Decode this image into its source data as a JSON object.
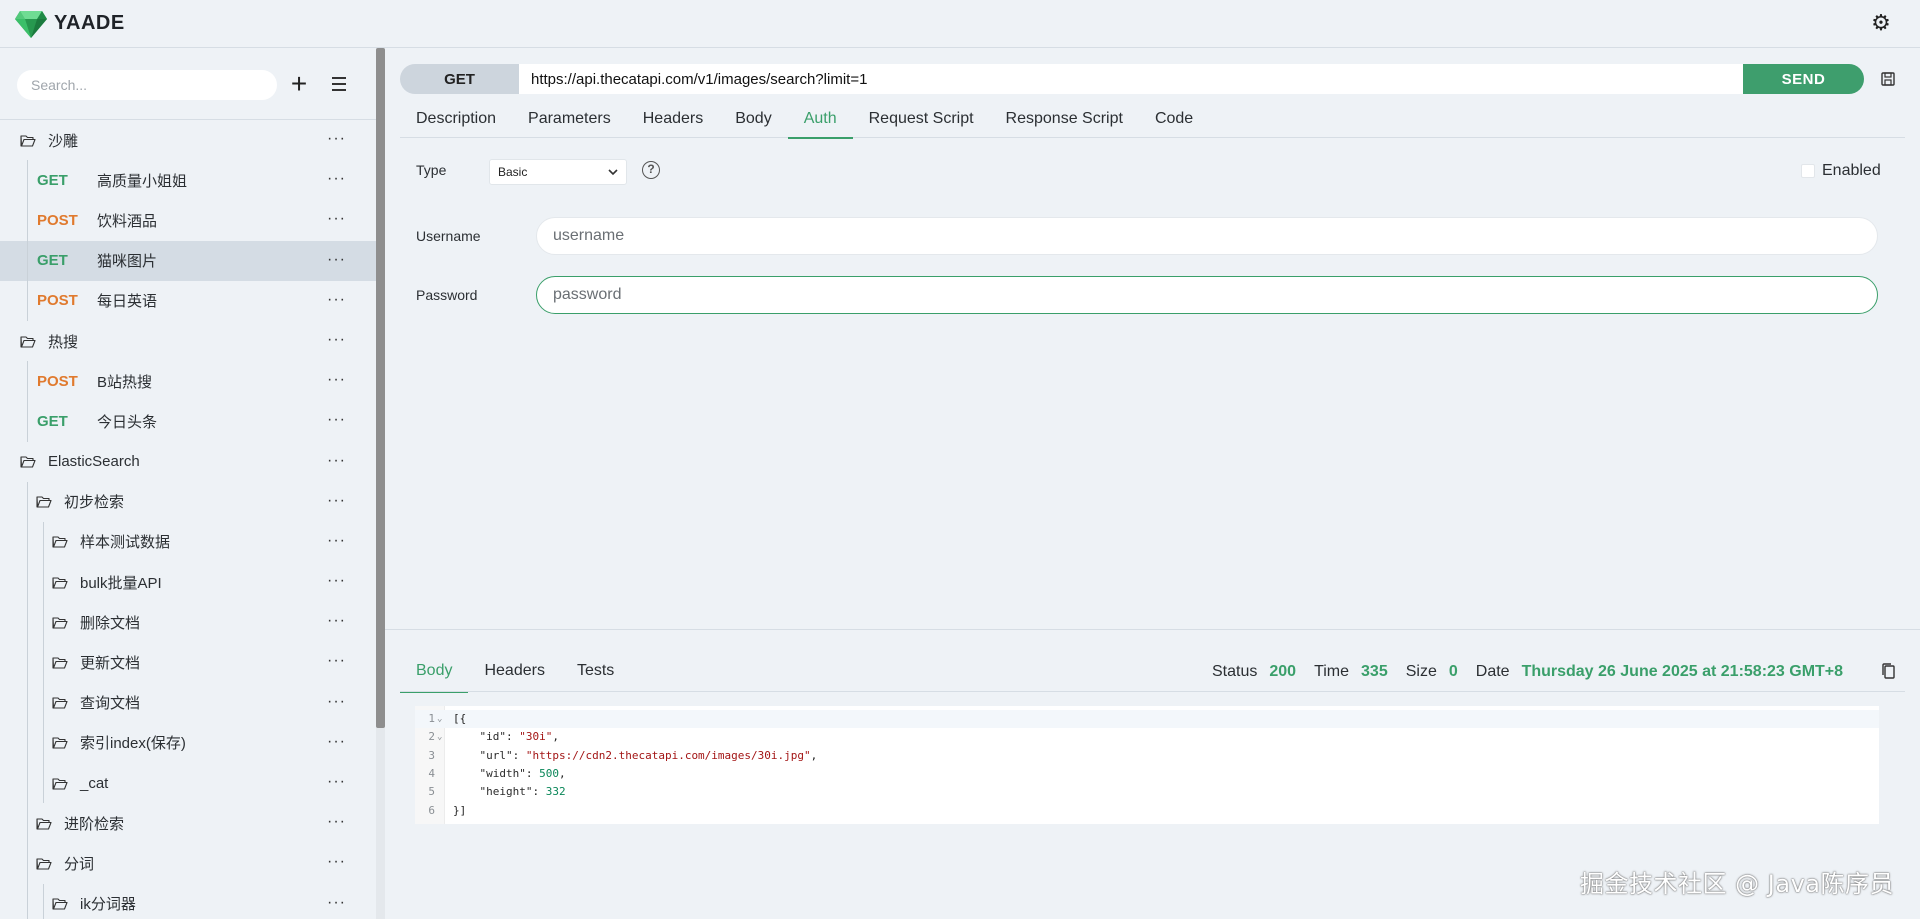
{
  "app": {
    "title": "YAADE",
    "brand_color": "#3a9f6a",
    "logo_icon": "emerald-gem-icon",
    "settings_icon": "gear-icon"
  },
  "sidebar": {
    "search": {
      "placeholder": "Search..."
    },
    "add_icon": "plus-icon",
    "menu_icon": "hamburger-icon",
    "items": [
      {
        "kind": "folder",
        "label": "沙雕",
        "depth": 0
      },
      {
        "kind": "request",
        "method": "GET",
        "label": "高质量小姐姐",
        "depth": 1
      },
      {
        "kind": "request",
        "method": "POST",
        "label": "饮料酒品",
        "depth": 1
      },
      {
        "kind": "request",
        "method": "GET",
        "label": "猫咪图片",
        "depth": 1,
        "selected": true
      },
      {
        "kind": "request",
        "method": "POST",
        "label": "每日英语",
        "depth": 1
      },
      {
        "kind": "folder",
        "label": "热搜",
        "depth": 0
      },
      {
        "kind": "request",
        "method": "POST",
        "label": "B站热搜",
        "depth": 1
      },
      {
        "kind": "request",
        "method": "GET",
        "label": "今日头条",
        "depth": 1
      },
      {
        "kind": "folder",
        "label": "ElasticSearch",
        "depth": 0
      },
      {
        "kind": "folder",
        "label": "初步检索",
        "depth": 1
      },
      {
        "kind": "folder",
        "label": "样本测试数据",
        "depth": 2
      },
      {
        "kind": "folder",
        "label": "bulk批量API",
        "depth": 2
      },
      {
        "kind": "folder",
        "label": "删除文档",
        "depth": 2
      },
      {
        "kind": "folder",
        "label": "更新文档",
        "depth": 2
      },
      {
        "kind": "folder",
        "label": "查询文档",
        "depth": 2
      },
      {
        "kind": "folder",
        "label": "索引index(保存)",
        "depth": 2
      },
      {
        "kind": "folder",
        "label": "_cat",
        "depth": 2
      },
      {
        "kind": "folder",
        "label": "进阶检索",
        "depth": 1
      },
      {
        "kind": "folder",
        "label": "分词",
        "depth": 1
      },
      {
        "kind": "folder",
        "label": "ik分词器",
        "depth": 2
      }
    ],
    "more_glyph": "···"
  },
  "request": {
    "method": "GET",
    "url": "https://api.thecatapi.com/v1/images/search?limit=1",
    "send_label": "SEND",
    "save_icon": "save-icon",
    "tabs": [
      "Description",
      "Parameters",
      "Headers",
      "Body",
      "Auth",
      "Request Script",
      "Response Script",
      "Code"
    ],
    "active_tab": "Auth"
  },
  "auth": {
    "type_label": "Type",
    "type_value": "Basic",
    "help_icon": "question-circle-icon",
    "enabled_label": "Enabled",
    "enabled": false,
    "username_label": "Username",
    "username_placeholder": "username",
    "password_label": "Password",
    "password_placeholder": "password"
  },
  "response": {
    "tabs": [
      "Body",
      "Headers",
      "Tests"
    ],
    "active_tab": "Body",
    "status_label": "Status",
    "status_value": "200",
    "time_label": "Time",
    "time_value": "335",
    "size_label": "Size",
    "size_value": "0",
    "date_label": "Date",
    "date_value": "Thursday 26 June 2025 at 21:58:23 GMT+8",
    "copy_icon": "copy-icon",
    "body_lines": [
      {
        "n": "1",
        "fold": "⌄",
        "text": "[{"
      },
      {
        "n": "2",
        "fold": "⌄",
        "text": "    \"id\": \"30i\","
      },
      {
        "n": "3",
        "fold": "",
        "text": "    \"url\": \"https://cdn2.thecatapi.com/images/30i.jpg\","
      },
      {
        "n": "4",
        "fold": "",
        "text": "    \"width\": 500,"
      },
      {
        "n": "5",
        "fold": "",
        "text": "    \"height\": 332"
      },
      {
        "n": "6",
        "fold": "",
        "text": "}]"
      }
    ]
  },
  "watermark": "掘金技术社区 @ Java陈序员"
}
